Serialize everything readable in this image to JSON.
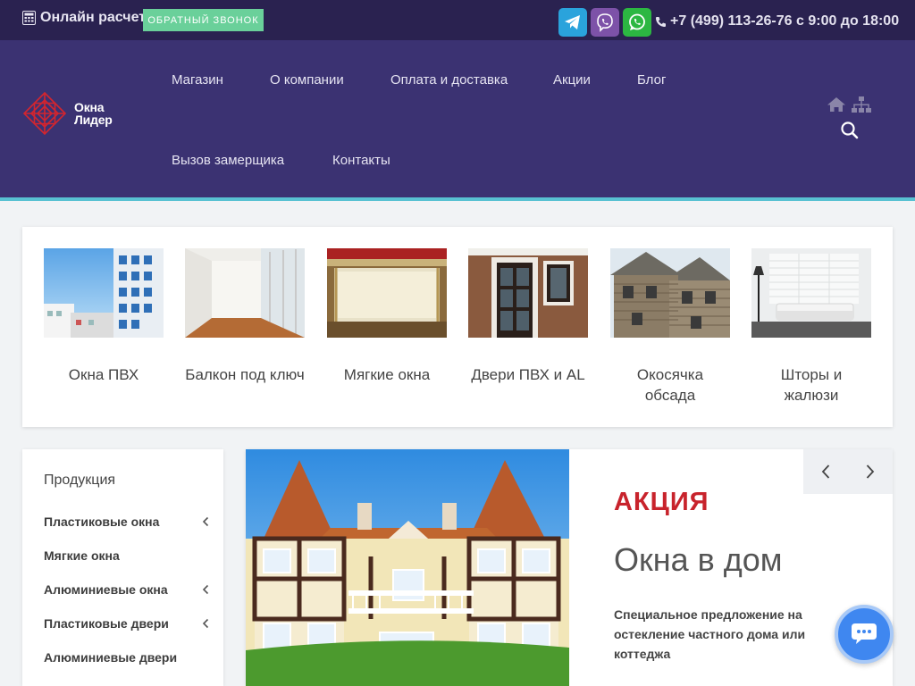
{
  "topbar": {
    "calc_label": "Онлайн расчет",
    "callback_label": "ОБРАТНЫЙ ЗВОНОК",
    "phone": "+7 (499) 113-26-76 с 9:00 до 18:00",
    "messengers": [
      "telegram-icon",
      "viber-icon",
      "whatsapp-icon"
    ]
  },
  "header": {
    "logo_line1": "Окна",
    "logo_line2": "Лидер",
    "nav": [
      "Магазин",
      "О компании",
      "Оплата и доставка",
      "Акции",
      "Блог",
      "Вызов замерщика",
      "Контакты"
    ]
  },
  "categories": [
    {
      "label": "Окна ПВХ"
    },
    {
      "label": "Балкон под ключ"
    },
    {
      "label": "Мягкие окна"
    },
    {
      "label": "Двери ПВХ и AL"
    },
    {
      "label": "Окосячка обсада"
    },
    {
      "label": "Шторы и жалюзи"
    }
  ],
  "sidebar": {
    "title": "Продукция",
    "items": [
      {
        "label": "Пластиковые окна",
        "expandable": true
      },
      {
        "label": "Мягкие окна",
        "expandable": false
      },
      {
        "label": "Алюминиевые окна",
        "expandable": true
      },
      {
        "label": "Пластиковые двери",
        "expandable": true
      },
      {
        "label": "Алюминиевые двери",
        "expandable": false
      }
    ]
  },
  "slider": {
    "tag": "АКЦИЯ",
    "title": "Окна в дом",
    "description": "Специальное предложение на остекление частного дома или коттеджа"
  },
  "colors": {
    "topbar": "#2a2250",
    "header": "#3b3272",
    "accent_line": "#58c1d2",
    "callback": "#6ad09a",
    "promo_red": "#c8232c",
    "chat": "#3f87f0"
  }
}
